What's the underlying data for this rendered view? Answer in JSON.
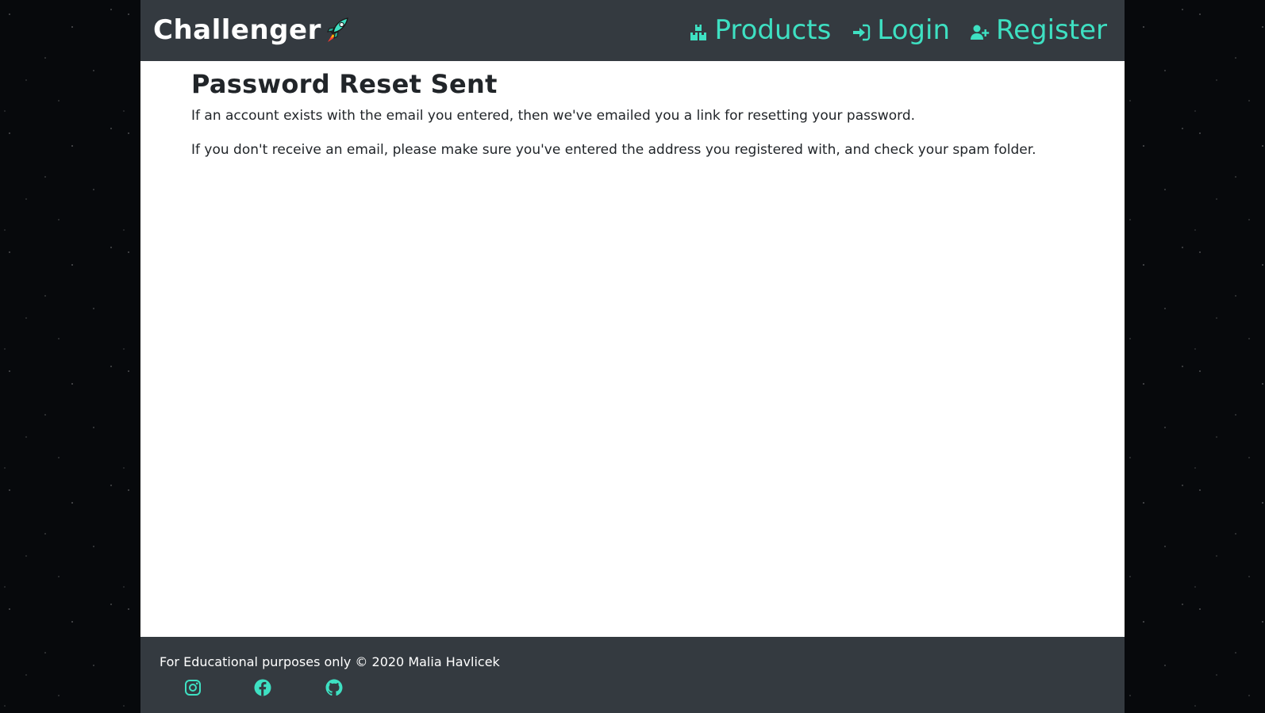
{
  "navbar": {
    "brand": "Challenger",
    "brand_icon": "rocket-icon",
    "links": [
      {
        "label": "Products",
        "icon": "boxes-icon"
      },
      {
        "label": "Login",
        "icon": "sign-in-icon"
      },
      {
        "label": "Register",
        "icon": "user-plus-icon"
      }
    ]
  },
  "main": {
    "title": "Password Reset Sent",
    "messages": [
      "If an account exists with the email you entered, then we've emailed you a link for resetting your password.",
      "If you don't receive an email, please make sure you've entered the address you registered with, and check your spam folder."
    ]
  },
  "footer": {
    "text": "For Educational purposes only © 2020 Malia Havlicek",
    "social": [
      "instagram-icon",
      "facebook-icon",
      "github-icon"
    ]
  },
  "colors": {
    "accent": "#3ee0c2",
    "navbar_bg": "#343a40",
    "content_bg": "#ffffff",
    "page_bg": "#07090c"
  }
}
